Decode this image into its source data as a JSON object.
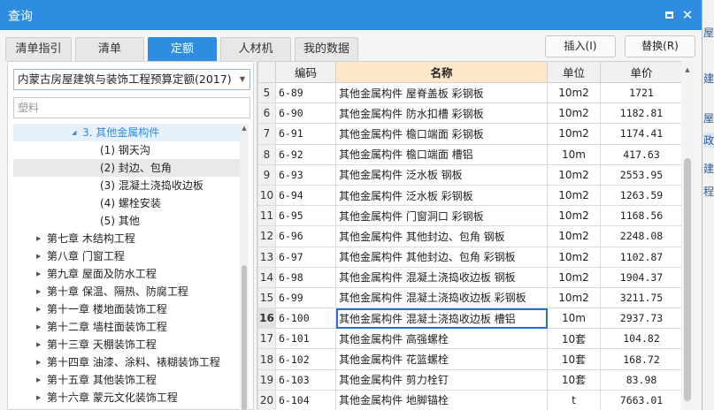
{
  "window": {
    "title": "查询"
  },
  "tabs": [
    "清单指引",
    "清单",
    "定额",
    "人材机",
    "我的数据"
  ],
  "active_tab": "定额",
  "actions": {
    "insert": "插入(I)",
    "replace": "替换(R)"
  },
  "library": {
    "selected": "内蒙古房屋建筑与装饰工程预算定额(2017)"
  },
  "search": {
    "value": "塑料"
  },
  "tree": [
    {
      "label": "3. 其他金属构件",
      "level": 1,
      "expanded": true
    },
    {
      "label": "(1) 钢天沟",
      "level": 2
    },
    {
      "label": "(2) 封边、包角",
      "level": 2
    },
    {
      "label": "(3) 混凝土浇捣收边板",
      "level": 2
    },
    {
      "label": "(4) 螺栓安装",
      "level": 2
    },
    {
      "label": "(5) 其他",
      "level": 2
    },
    {
      "label": "第七章 木结构工程",
      "level": 0
    },
    {
      "label": "第八章 门窗工程",
      "level": 0
    },
    {
      "label": "第九章 屋面及防水工程",
      "level": 0
    },
    {
      "label": "第十章 保温、隔热、防腐工程",
      "level": 0
    },
    {
      "label": "第十一章 楼地面装饰工程",
      "level": 0
    },
    {
      "label": "第十二章 墙柱面装饰工程",
      "level": 0
    },
    {
      "label": "第十三章 天棚装饰工程",
      "level": 0
    },
    {
      "label": "第十四章 油漆、涂料、裱糊装饰工程",
      "level": 0
    },
    {
      "label": "第十五章 其他装饰工程",
      "level": 0
    },
    {
      "label": "第十六章 蒙元文化装饰工程",
      "level": 0
    }
  ],
  "grid": {
    "columns": [
      "编码",
      "名称",
      "单位",
      "单价"
    ],
    "rows": [
      {
        "no": "5",
        "code": "6-89",
        "name": "其他金属构件 屋脊盖板 彩钢板",
        "unit": "10m2",
        "price": "1721"
      },
      {
        "no": "6",
        "code": "6-90",
        "name": "其他金属构件 防水扣槽 彩钢板",
        "unit": "10m2",
        "price": "1182.81"
      },
      {
        "no": "7",
        "code": "6-91",
        "name": "其他金属构件 檐口端面 彩钢板",
        "unit": "10m2",
        "price": "1174.41"
      },
      {
        "no": "8",
        "code": "6-92",
        "name": "其他金属构件 檐口端面 槽铝",
        "unit": "10m",
        "price": "417.63"
      },
      {
        "no": "9",
        "code": "6-93",
        "name": "其他金属构件 泛水板 钢板",
        "unit": "10m2",
        "price": "2553.95"
      },
      {
        "no": "10",
        "code": "6-94",
        "name": "其他金属构件 泛水板 彩钢板",
        "unit": "10m2",
        "price": "1263.59"
      },
      {
        "no": "11",
        "code": "6-95",
        "name": "其他金属构件 门窗洞口 彩钢板",
        "unit": "10m2",
        "price": "1168.56"
      },
      {
        "no": "12",
        "code": "6-96",
        "name": "其他金属构件 其他封边、包角 钢板",
        "unit": "10m2",
        "price": "2248.08"
      },
      {
        "no": "13",
        "code": "6-97",
        "name": "其他金属构件 其他封边、包角 彩钢板",
        "unit": "10m2",
        "price": "1102.87"
      },
      {
        "no": "14",
        "code": "6-98",
        "name": "其他金属构件 混凝土浇捣收边板 钢板",
        "unit": "10m2",
        "price": "1904.37"
      },
      {
        "no": "15",
        "code": "6-99",
        "name": "其他金属构件 混凝土浇捣收边板 彩钢板",
        "unit": "10m2",
        "price": "3211.75"
      },
      {
        "no": "16",
        "code": "6-100",
        "name": "其他金属构件 混凝土浇捣收边板 槽铝",
        "unit": "10m",
        "price": "2937.73"
      },
      {
        "no": "17",
        "code": "6-101",
        "name": "其他金属构件 高强螺栓",
        "unit": "10套",
        "price": "104.82"
      },
      {
        "no": "18",
        "code": "6-102",
        "name": "其他金属构件 花篮螺栓",
        "unit": "10套",
        "price": "168.72"
      },
      {
        "no": "19",
        "code": "6-103",
        "name": "其他金属构件 剪力栓钉",
        "unit": "10套",
        "price": "83.98"
      },
      {
        "no": "20",
        "code": "6-104",
        "name": "其他金属构件 地脚锚栓",
        "unit": "t",
        "price": "7663.01"
      }
    ],
    "selected_row": "16"
  },
  "right_strip": [
    "屋",
    "建筑",
    "屋",
    "政",
    "建筑",
    "程"
  ]
}
